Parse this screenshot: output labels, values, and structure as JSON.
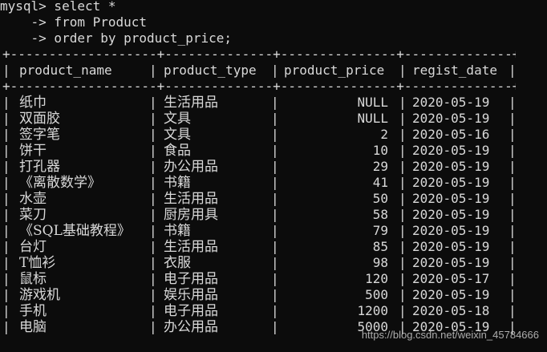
{
  "prompt": {
    "line1": "mysql> select *",
    "line2": "    -> from Product",
    "line3": "    -> order by product_price;"
  },
  "table": {
    "border_top": "+-------------------+--------------+---------------+--------------+",
    "header_sep": "+-------------------+--------------+---------------+--------------+",
    "columns": [
      "product_name",
      "product_type",
      "product_price",
      "regist_date"
    ],
    "rows": [
      {
        "name": "纸巾",
        "type": "生活用品",
        "price": "NULL",
        "date": "2020-05-19"
      },
      {
        "name": "双面胶",
        "type": "文具",
        "price": "NULL",
        "date": "2020-05-19"
      },
      {
        "name": "签字笔",
        "type": "文具",
        "price": "2",
        "date": "2020-05-16"
      },
      {
        "name": "饼干",
        "type": "食品",
        "price": "10",
        "date": "2020-05-19"
      },
      {
        "name": "打孔器",
        "type": "办公用品",
        "price": "29",
        "date": "2020-05-19"
      },
      {
        "name": "《离散数学》",
        "type": "书籍",
        "price": "41",
        "date": "2020-05-19"
      },
      {
        "name": "水壶",
        "type": "生活用品",
        "price": "50",
        "date": "2020-05-19"
      },
      {
        "name": "菜刀",
        "type": "厨房用具",
        "price": "58",
        "date": "2020-05-19"
      },
      {
        "name": "《SQL基础教程》",
        "type": "书籍",
        "price": "79",
        "date": "2020-05-19"
      },
      {
        "name": "台灯",
        "type": "生活用品",
        "price": "85",
        "date": "2020-05-19"
      },
      {
        "name": "T恤衫",
        "type": "衣服",
        "price": "98",
        "date": "2020-05-19"
      },
      {
        "name": "鼠标",
        "type": "电子用品",
        "price": "120",
        "date": "2020-05-17"
      },
      {
        "name": "游戏机",
        "type": "娱乐用品",
        "price": "500",
        "date": "2020-05-19"
      },
      {
        "name": "手机",
        "type": "电子用品",
        "price": "1200",
        "date": "2020-05-18"
      },
      {
        "name": "电脑",
        "type": "办公用品",
        "price": "5000",
        "date": "2020-05-19"
      }
    ]
  },
  "watermark": "https://blog.csdn.net/weixin_45784666",
  "colors": {
    "background": "#0c0c0c",
    "text": "#d9d9d9"
  }
}
